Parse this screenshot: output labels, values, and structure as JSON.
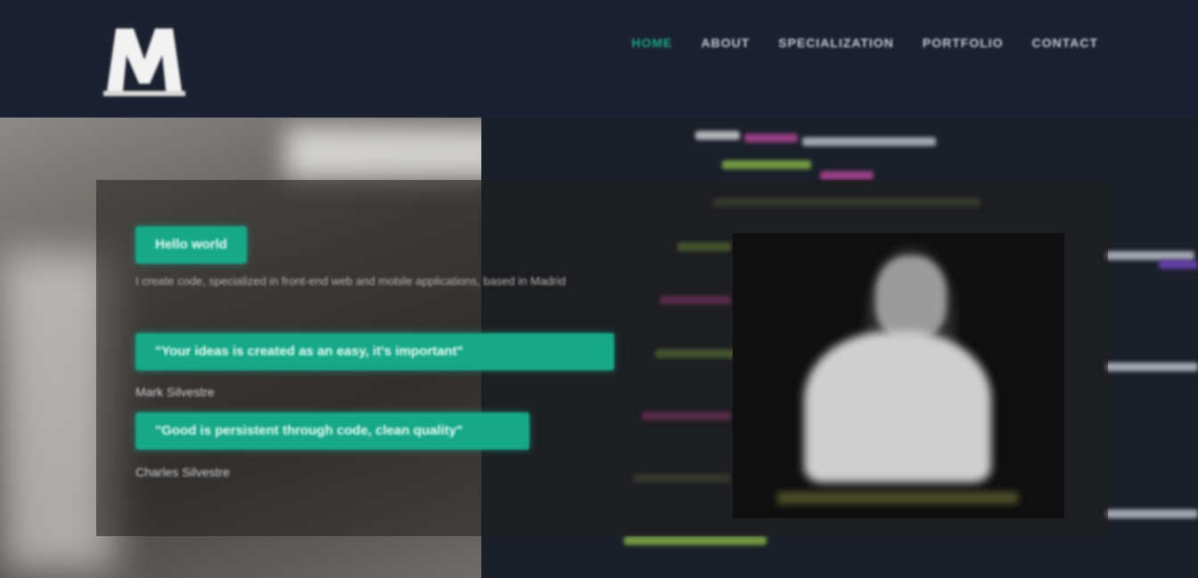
{
  "header": {
    "logo_text": "M",
    "nav": [
      {
        "label": "HOME",
        "active": true
      },
      {
        "label": "ABOUT",
        "active": false
      },
      {
        "label": "SPECIALIZATION",
        "active": false
      },
      {
        "label": "PORTFOLIO",
        "active": false
      },
      {
        "label": "CONTACT",
        "active": false
      }
    ]
  },
  "hero": {
    "badge1": "Hello world",
    "line1": "I create code, specialized in front-end web and mobile applications, based in Madrid",
    "badge2": "\"Your ideas is created as an easy, it's important\"",
    "line2": "Mark Silvestre",
    "badge3": "\"Good is persistent through code, clean quality\"",
    "line3": "Charles Silvestre"
  },
  "colors": {
    "accent": "#17a887",
    "header_bg": "#1b2130",
    "code_bg": "#1a1f29"
  }
}
